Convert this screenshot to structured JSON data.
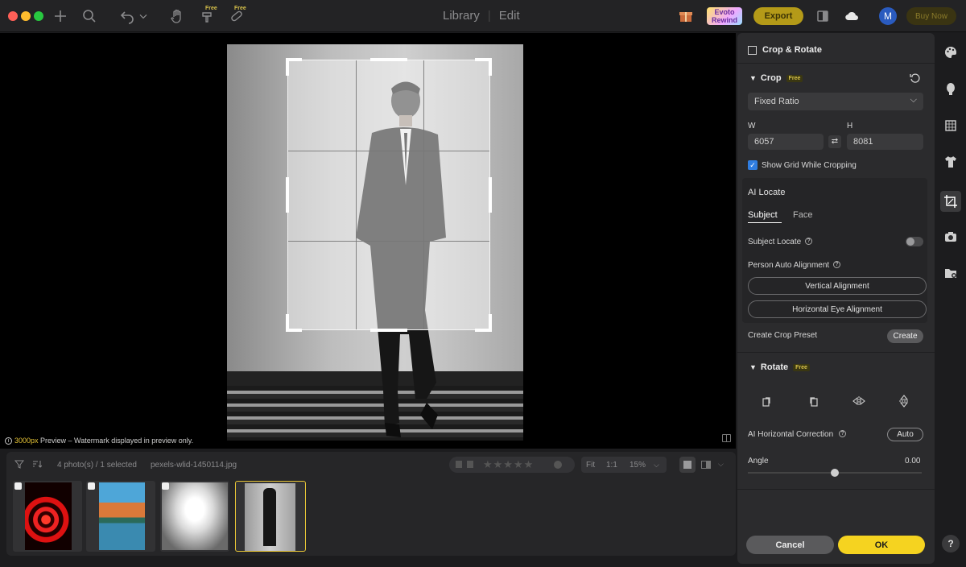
{
  "titlebar": {
    "mode_tabs": [
      "Library",
      "Edit"
    ],
    "free_tag_1": "Free",
    "free_tag_2": "Free",
    "evoto_badge": "Evoto Rewind",
    "export_label": "Export",
    "avatar_initial": "M",
    "buy_now_label": "Buy Now"
  },
  "canvas": {
    "preview_px": "3000px",
    "preview_note": " Preview – Watermark displayed in preview only."
  },
  "filmstrip": {
    "photo_count": "4 photo(s) / 1 selected",
    "file_name": "pexels-wlid-1450114.jpg",
    "zoom_fit": "Fit",
    "zoom_1to1": "1:1",
    "zoom_level": "15%",
    "thumbnails": [
      {
        "name": "red-spiral"
      },
      {
        "name": "colorful-houses"
      },
      {
        "name": "white-corridor"
      },
      {
        "name": "man-in-suit"
      }
    ]
  },
  "panel": {
    "title": "Crop & Rotate",
    "crop": {
      "label": "Crop",
      "free": "Free",
      "ratio_value": "Fixed Ratio",
      "w_label": "W",
      "h_label": "H",
      "w_value": "6057",
      "h_value": "8081",
      "show_grid_label": "Show Grid While Cropping",
      "show_grid_checked": true
    },
    "ai_locate": {
      "title": "AI Locate",
      "tabs": [
        "Subject",
        "Face"
      ],
      "active_tab": "Subject",
      "subject_locate_label": "Subject Locate",
      "person_alignment_label": "Person Auto Alignment",
      "vertical_btn": "Vertical Alignment",
      "horizontal_btn": "Horizontal Eye Alignment"
    },
    "preset": {
      "label": "Create Crop Preset",
      "button": "Create"
    },
    "rotate": {
      "label": "Rotate",
      "free": "Free",
      "horizontal_correction_label": "AI Horizontal Correction",
      "auto_button": "Auto",
      "angle_label": "Angle",
      "angle_value": "0.00",
      "angle_slider_position": 0.5
    },
    "footer": {
      "cancel": "Cancel",
      "ok": "OK"
    }
  },
  "rail": {
    "help": "?"
  },
  "colors": {
    "accent_yellow": "#f5d320",
    "checkbox_blue": "#2f7de1",
    "export_gold": "#b49a18"
  }
}
